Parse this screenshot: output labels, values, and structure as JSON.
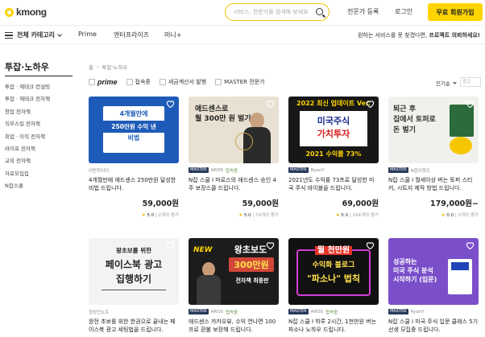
{
  "header": {
    "logo_text": "kmong",
    "search_placeholder": "서비스, 전문가를 검색해 보세요",
    "links": [
      "전문가 등록",
      "로그인"
    ],
    "join_button": "무료 회원가입"
  },
  "nav": {
    "category_label": "전체 카테고리",
    "items": [
      "Prime",
      "엔터프라이즈",
      "머니+"
    ],
    "promo_text": "원하는 서비스를 못 찾겠다면,",
    "promo_bold": "프로젝트 의뢰하세요!"
  },
  "sidebar": {
    "title": "투잡·노하우",
    "items": [
      "투잡 · 재테크 컨설팅",
      "투잡 · 재테크 전자책",
      "창업 전자책",
      "직무스킬 전자책",
      "취업 · 이직 전자책",
      "라이프 전자책",
      "교육 전자책",
      "자료모집집",
      "N잡스쿨"
    ]
  },
  "breadcrumb": {
    "home": "홈",
    "current": "투잡·노하우"
  },
  "filters": {
    "prime": "prime",
    "items": [
      "접속중",
      "세금계산서 발행",
      "MASTER 전문가"
    ]
  },
  "sort": {
    "label": "인기순",
    "input_placeholder": "광고"
  },
  "cards": [
    {
      "badge": "",
      "seller": "이반하이다",
      "verified": "",
      "title": "4개월만에 애드센스 250만원 달성한 비법 드립니다.",
      "price": "59,000원",
      "score": "5.0",
      "reviews": "2개의 평가",
      "thumb": {
        "lines": [
          "4개월만에",
          "250만원 수익 낸",
          "비법"
        ],
        "bg": "#1e5bb8"
      }
    },
    {
      "badge": "MASTER",
      "seller": "AROS",
      "verified": "접속중",
      "title": "N잡 스쿨 I 마로스의 애드센스 승인 4주 보장스쿨 드립니다.",
      "price": "59,000원",
      "score": "5.0",
      "reviews": "79개의 평가",
      "thumb": {
        "lines": [
          "애드센스로",
          "월 300만 원 벌기"
        ],
        "bg": "#e8e1d3"
      }
    },
    {
      "badge": "MASTER",
      "seller": "RyanY",
      "verified": "",
      "title": "2021년도 수익률 73프로 달성한 미국 주식 바이블을 드립니다.",
      "price": "69,000원",
      "score": "5.0",
      "reviews": "294개의 평가",
      "thumb": {
        "lines": [
          "2022 최신 업데이트 Ver.",
          "미국주식",
          "가치투자",
          "2021 수익률 73%"
        ],
        "bg": "#171717"
      }
    },
    {
      "badge": "MASTER",
      "seller": "N잡이랑도",
      "verified": "",
      "title": "N잡 스쿨 I 월세이상 버는 토퍼 스티커, 시트지 제작 방법 드립니다.",
      "price": "179,000원~",
      "score": "0.0",
      "reviews": "0개의 평가",
      "thumb": {
        "lines": [
          "퇴근 후",
          "집에서 토퍼로",
          "돈 벌기"
        ],
        "bg": "#f0f0ec"
      }
    },
    {
      "badge": "",
      "seller": "정성언노트",
      "verified": "",
      "title": "완전 초보를 위한 한권으로 끝내는 페이스북 광고 세팅법을 드립니다.",
      "price": "",
      "score": "",
      "reviews": "",
      "thumb": {
        "lines": [
          "왕초보를 위한",
          "페이스북 광고",
          "집행하기"
        ],
        "bg": "#f3f3f3"
      }
    },
    {
      "badge": "MASTER",
      "seller": "AROS",
      "verified": "접속중",
      "title": "애드센스 카카오뷰, 수익 연나면 100프로 환불 보장해 드립니다.",
      "price": "",
      "score": "",
      "reviews": "",
      "thumb": {
        "lines": [
          "NEW",
          "왕초보도",
          "300만원",
          "전자책 최종판"
        ],
        "bg": "#1c1c1c"
      }
    },
    {
      "badge": "MASTER",
      "seller": "AROS",
      "verified": "접속중",
      "title": "N잡 스쿨 I 하루 2시간, 1천만원 버는 파소나 노하우 드립니다.",
      "price": "",
      "score": "",
      "reviews": "",
      "thumb": {
        "lines": [
          "월 천만원",
          "수익화 블로그",
          "\"파소나\" 법칙"
        ],
        "bg": "#111111"
      }
    },
    {
      "badge": "MASTER",
      "seller": "RyanY",
      "verified": "",
      "title": "N잡 스쿨 I 미국 주식 입문 클래스 5기 선생 모집중 드립니다.",
      "price": "",
      "score": "",
      "reviews": "",
      "thumb": {
        "lines": [
          "성공하는",
          "미국 주식 분석",
          "시작하기 (입문)"
        ],
        "bg": "#7a4fc9"
      }
    }
  ]
}
